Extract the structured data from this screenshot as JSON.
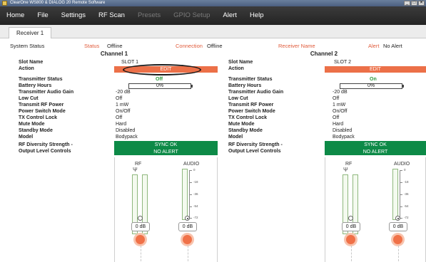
{
  "window": {
    "title": "ClearOne WS800 & DIALOG 20 Remote Software",
    "controls": [
      "_",
      "□",
      "✕"
    ]
  },
  "menu": {
    "items": [
      {
        "label": "Home",
        "enabled": true
      },
      {
        "label": "File",
        "enabled": true
      },
      {
        "label": "Settings",
        "enabled": true
      },
      {
        "label": "RF Scan",
        "enabled": true
      },
      {
        "label": "Presets",
        "enabled": false
      },
      {
        "label": "GPIO Setup",
        "enabled": false
      },
      {
        "label": "Alert",
        "enabled": true
      },
      {
        "label": "Help",
        "enabled": true
      }
    ]
  },
  "tabs": [
    {
      "label": "Receiver 1"
    }
  ],
  "status": {
    "system_label": "System Status",
    "status_label": "Status",
    "status_value": "Offline",
    "connection_label": "Connection",
    "connection_value": "Offline",
    "receiver_name_label": "Receiver Name",
    "alert_label": "Alert",
    "alert_value": "No Alert"
  },
  "labels": {
    "slot_name": "Slot Name",
    "action": "Action",
    "tx_status": "Transmitter Status",
    "battery": "Battery Hours",
    "tx_gain": "Transmitter Audio Gain",
    "low_cut": "Low Cut",
    "rf_power": "Transmit RF Power",
    "switch_mode": "Power Switch Mode",
    "tx_lock": "TX Control Lock",
    "mute_mode": "Mute Mode",
    "standby_mode": "Standby Mode",
    "model": "Model",
    "diversity_1": "RF Diversity Strength -",
    "diversity_2": "Output Level Controls",
    "rf_meter": "RF",
    "audio_meter": "AUDIO"
  },
  "channels": [
    {
      "header": "Channel 1",
      "slot_name": "SLOT 1",
      "action": "EDIT",
      "tx_status": "Off",
      "battery": "0%",
      "battery_level": 0,
      "tx_gain": "-20 dB",
      "low_cut": "Off",
      "rf_power": "1 mW",
      "switch_mode": "On/Off",
      "tx_lock": "Off",
      "mute_mode": "Hard",
      "standby_mode": "Disabled",
      "model": "Bodypack",
      "sync": "SYNC OK",
      "alert": "NO ALERT",
      "rf_db": "0 dB",
      "audio_db": "0 dB"
    },
    {
      "header": "Channel 2",
      "slot_name": "SLOT 2",
      "action": "EDIT",
      "tx_status": "On",
      "battery": "0%",
      "battery_level": 0,
      "tx_gain": "-20 dB",
      "low_cut": "Off",
      "rf_power": "1 mW",
      "switch_mode": "On/Off",
      "tx_lock": "Off",
      "mute_mode": "Hard",
      "standby_mode": "Disabled",
      "model": "Bodypack",
      "sync": "SYNC OK",
      "alert": "NO ALERT",
      "rf_db": "0 dB",
      "audio_db": "0 dB"
    }
  ],
  "audio_scale": [
    "0",
    "-18",
    "-36",
    "-54",
    "-72"
  ],
  "colors": {
    "menu_bg": "#2c2c2c",
    "edit_button": "#ec7048",
    "status_green": "#0d8a47",
    "on_text": "#2f9a3e",
    "label_red": "#e05a3a"
  }
}
